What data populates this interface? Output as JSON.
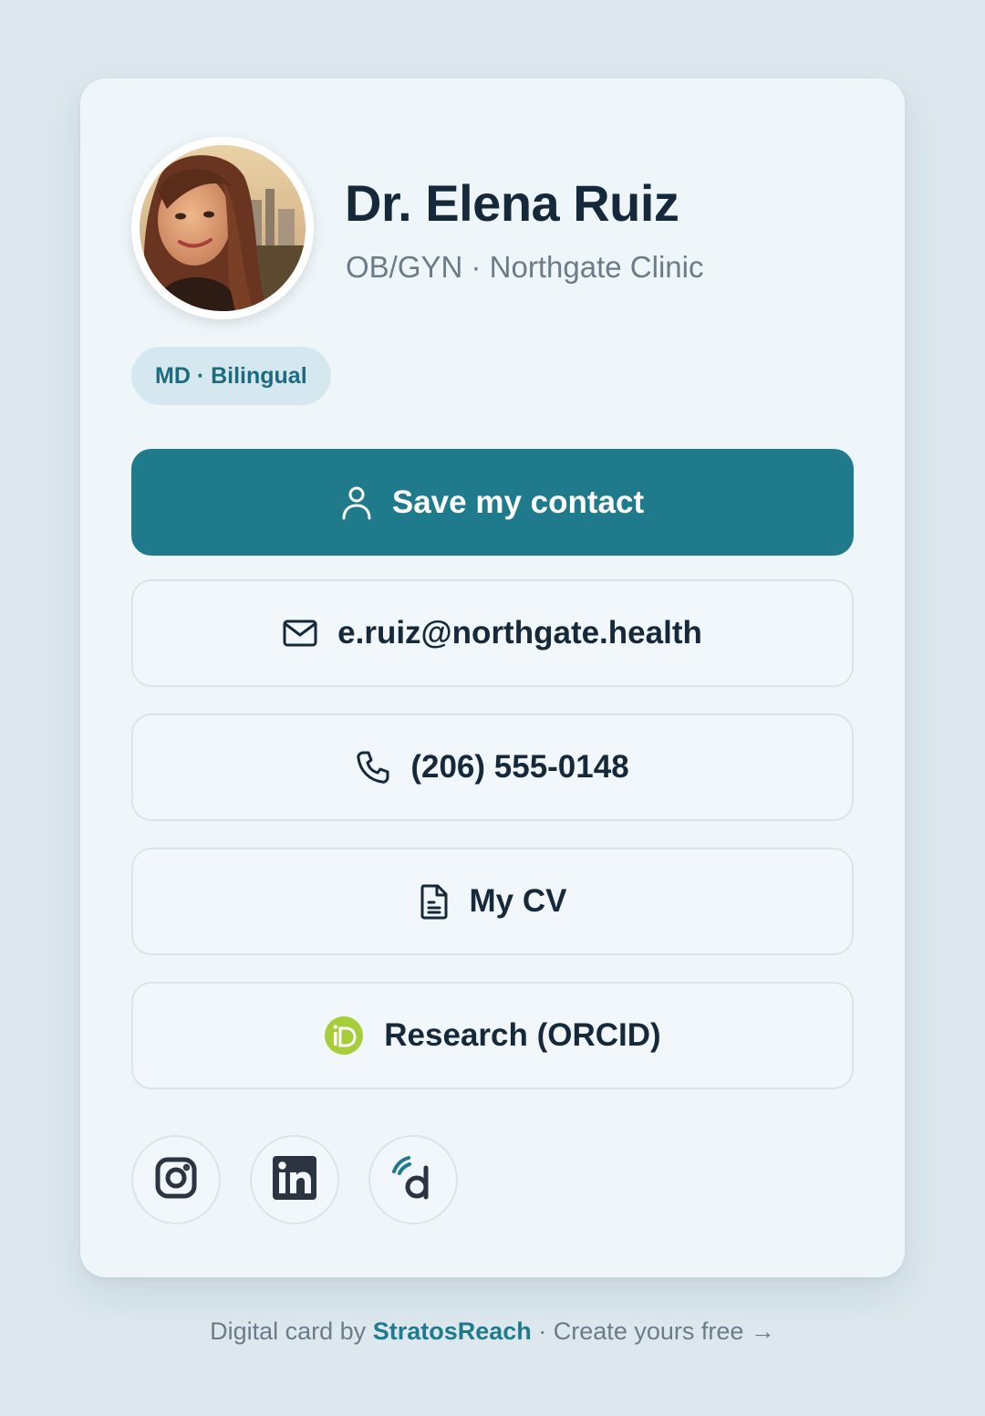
{
  "profile": {
    "name": "Dr. Elena Ruiz",
    "subtitle": "OB/GYN · Northgate Clinic",
    "badge": "MD · Bilingual",
    "avatar_icon": "profile-photo"
  },
  "actions": {
    "save_contact": {
      "label": "Save my contact",
      "icon": "person-icon"
    },
    "email": {
      "label": "e.ruiz@northgate.health",
      "icon": "mail-icon"
    },
    "phone": {
      "label": "(206) 555-0148",
      "icon": "phone-icon"
    },
    "cv": {
      "label": "My CV",
      "icon": "document-icon"
    },
    "research": {
      "label": "Research (ORCID)",
      "icon": "orcid-icon"
    }
  },
  "social": [
    {
      "name": "instagram",
      "icon": "instagram-icon"
    },
    {
      "name": "linkedin",
      "icon": "linkedin-icon"
    },
    {
      "name": "doximity",
      "icon": "doximity-icon"
    }
  ],
  "footer": {
    "prefix": "Digital card by",
    "brand": "StratosReach",
    "suffix": "· Create yours free →"
  },
  "colors": {
    "background": "#dce7ee",
    "card": "#eff6fa",
    "primary": "#1f7a8c",
    "text": "#15293a",
    "muted": "#6b7b88",
    "badge_bg": "#d6e8ef",
    "orcid": "#a6ce39"
  }
}
